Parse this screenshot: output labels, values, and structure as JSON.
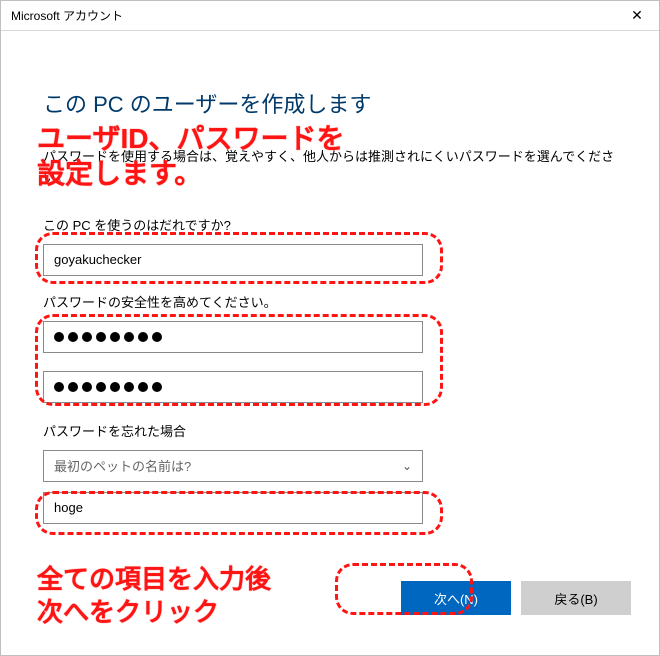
{
  "titlebar": {
    "title": "Microsoft アカウント"
  },
  "heading": "この PC のユーザーを作成します",
  "subtext": "パスワードを使用する場合は、覚えやすく、他人からは推測されにくいパスワードを選んでください。",
  "labels": {
    "who": "この PC を使うのはだれですか?",
    "pw": "パスワードの安全性を高めてください。",
    "forgot": "パスワードを忘れた場合"
  },
  "fields": {
    "username": "goyakuchecker",
    "password_len": 8,
    "password_confirm_len": 8,
    "security_question": "最初のペットの名前は?",
    "security_answer": "hoge"
  },
  "buttons": {
    "next": "次へ(N)",
    "back": "戻る(B)"
  },
  "annotations": {
    "a1": "ユーザID、パスワードを\n設定します。",
    "a2": "全ての項目を入力後\n次へをクリック"
  }
}
